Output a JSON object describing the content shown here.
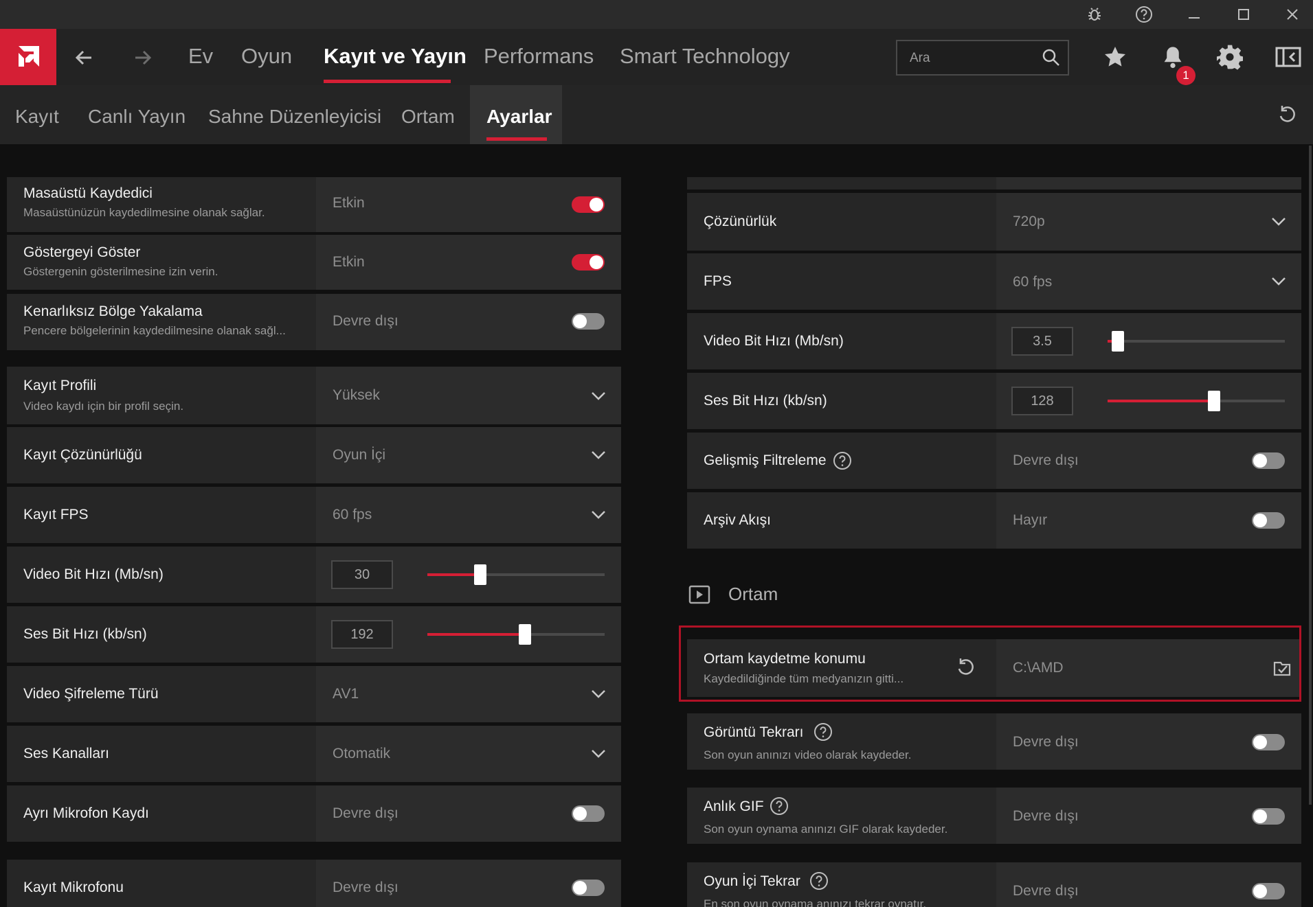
{
  "topnav": {
    "tabs": [
      "Ev",
      "Oyun",
      "Kayıt ve Yayın",
      "Performans",
      "Smart Technology"
    ],
    "search_placeholder": "Ara",
    "notification_count": "1"
  },
  "subnav": {
    "tabs": [
      "Kayıt",
      "Canlı Yayın",
      "Sahne Düzenleyicisi",
      "Ortam",
      "Ayarlar"
    ]
  },
  "left": {
    "masaustu_title": "Masaüstü Kaydedici",
    "masaustu_desc": "Masaüstünüzün kaydedilmesine olanak sağlar.",
    "masaustu_value": "Etkin",
    "gosterge_title": "Göstergeyi Göster",
    "gosterge_desc": "Göstergenin gösterilmesine izin verin.",
    "gosterge_value": "Etkin",
    "kenarliksiz_title": "Kenarlıksız Bölge Yakalama",
    "kenarliksiz_desc": "Pencere bölgelerinin kaydedilmesine olanak sağl...",
    "kenarliksiz_value": "Devre dışı",
    "profil_title": "Kayıt Profili",
    "profil_desc": "Video kaydı için bir profil seçin.",
    "profil_value": "Yüksek",
    "cozunurluk_title": "Kayıt Çözünürlüğü",
    "cozunurluk_value": "Oyun İçi",
    "fps_title": "Kayıt FPS",
    "fps_value": "60 fps",
    "vbit_title": "Video Bit Hızı (Mb/sn)",
    "vbit_value": "30",
    "vbit_level": 0.3,
    "sbit_title": "Ses Bit Hızı (kb/sn)",
    "sbit_value": "192",
    "sbit_level": 0.55,
    "sifre_title": "Video Şifreleme Türü",
    "sifre_value": "AV1",
    "kanal_title": "Ses Kanalları",
    "kanal_value": "Otomatik",
    "mikrofon_kaydi_title": "Ayrı Mikrofon Kaydı",
    "mikrofon_kaydi_value": "Devre dışı",
    "mikrofon_title": "Kayıt Mikrofonu",
    "mikrofon_value": "Devre dışı"
  },
  "right": {
    "cozunurluk_title": "Çözünürlük",
    "cozunurluk_value": "720p",
    "fps_title": "FPS",
    "fps_value": "60 fps",
    "vbit_title": "Video Bit Hızı (Mb/sn)",
    "vbit_value": "3.5",
    "vbit_level": 0.06,
    "sbit_title": "Ses Bit Hızı (kb/sn)",
    "sbit_value": "128",
    "sbit_level": 0.6,
    "filtre_title": "Gelişmiş Filtreleme",
    "filtre_value": "Devre dışı",
    "arsiv_title": "Arşiv Akışı",
    "arsiv_value": "Hayır",
    "section_title": "Ortam",
    "konum_title": "Ortam kaydetme konumu",
    "konum_desc": "Kaydedildiğinde tüm medyanızın gitti...",
    "konum_value": "C:\\AMD",
    "tekrar_title": "Görüntü Tekrarı",
    "tekrar_desc": "Son oyun anınızı video olarak kaydeder.",
    "tekrar_value": "Devre dışı",
    "gif_title": "Anlık GIF",
    "gif_desc": "Son oyun oynama anınızı GIF olarak kaydeder.",
    "gif_value": "Devre dışı",
    "oyunici_title": "Oyun İçi Tekrar",
    "oyunici_desc": "En son oyun oynama anınızı tekrar oynatır.",
    "oyunici_value": "Devre dışı"
  },
  "colors": {
    "accent": "#d51f35",
    "background": "#101010",
    "row": "#262626"
  },
  "icons": [
    "bug-icon",
    "help-icon",
    "minimize-icon",
    "maximize-icon",
    "close-icon",
    "amd-logo",
    "back-arrow-icon",
    "forward-arrow-icon",
    "search-icon",
    "star-icon",
    "bell-icon",
    "gear-icon",
    "sidebar-toggle-icon",
    "reset-icon",
    "chevron-down-icon",
    "question-icon",
    "play-icon",
    "folder-check-icon"
  ]
}
